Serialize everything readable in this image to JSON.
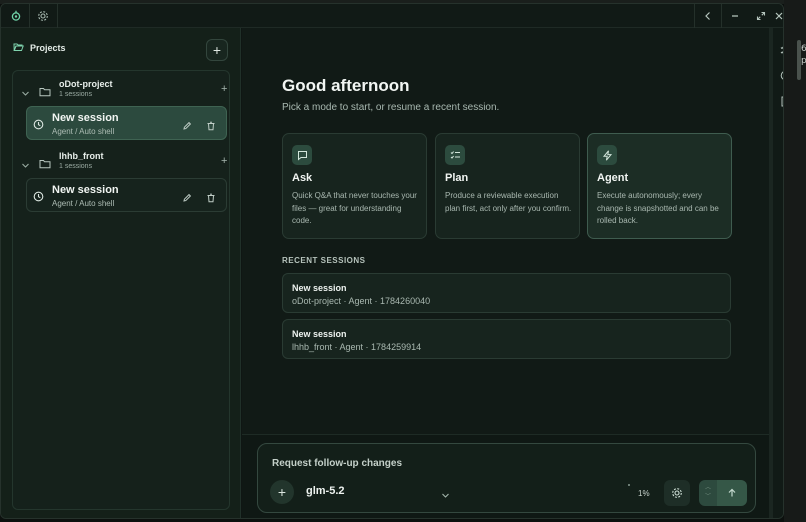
{
  "desktop": {
    "fragments": [
      "6",
      "p"
    ]
  },
  "titlebar": {
    "logo": "app-logo-icon",
    "settings": "gear-icon"
  },
  "window_controls": [
    "back-icon",
    "minimize-icon",
    "maximize-icon",
    "close-icon"
  ],
  "sidebar": {
    "header": "Projects",
    "add_label": "+",
    "projects": [
      {
        "name": "oDot-project",
        "count": "1 sessions",
        "add": "+",
        "sessions": [
          {
            "name": "New session",
            "meta": "Agent / Auto shell",
            "active": true
          }
        ]
      },
      {
        "name": "lhhb_front",
        "count": "1 sessions",
        "add": "+",
        "sessions": [
          {
            "name": "New session",
            "meta": "Agent / Auto shell",
            "active": false
          }
        ]
      }
    ]
  },
  "main": {
    "greeting": "Good afternoon",
    "subtitle": "Pick a mode to start, or resume a recent session.",
    "modes": [
      {
        "title": "Ask",
        "icon": "chat-bubble-icon",
        "desc": "Quick Q&A that never touches your files — great for understanding code."
      },
      {
        "title": "Plan",
        "icon": "checklist-icon",
        "desc": "Produce a reviewable execution plan first, act only after you confirm."
      },
      {
        "title": "Agent",
        "icon": "lightning-icon",
        "desc": "Execute autonomously; every change is snapshotted and can be rolled back.",
        "selected": true
      }
    ],
    "recent_heading": "RECENT SESSIONS",
    "recent": [
      {
        "title": "New session",
        "meta": "oDot-project · Agent · 1784260040"
      },
      {
        "title": "New session",
        "meta": "lhhb_front · Agent · 1784259914"
      }
    ]
  },
  "composer": {
    "placeholder": "Request follow-up changes",
    "attach": "+",
    "model": "glm-5.2",
    "usage": "1%",
    "stepper_up": "︿",
    "stepper_down": "﹀"
  },
  "rail": [
    "checklist-icon",
    "history-icon",
    "file-export-icon"
  ]
}
